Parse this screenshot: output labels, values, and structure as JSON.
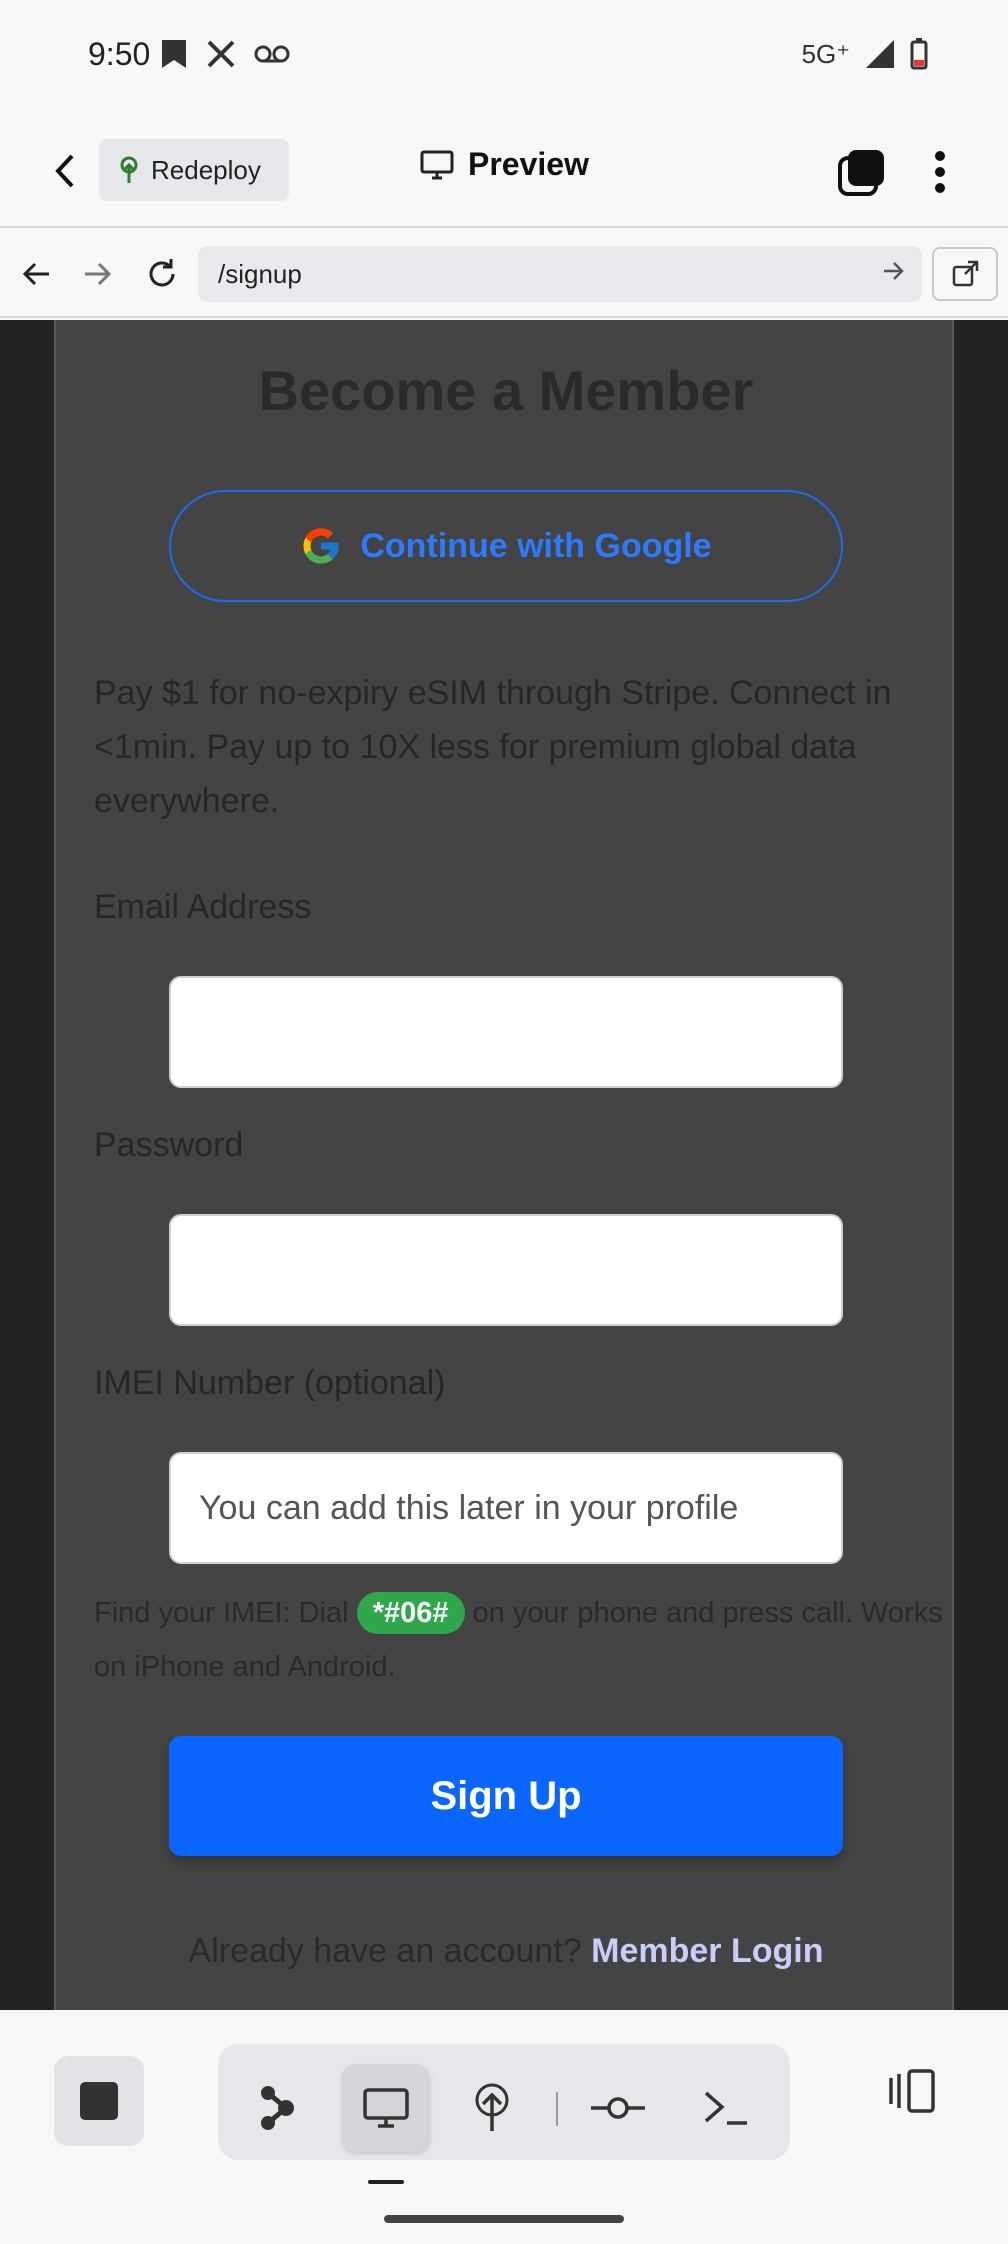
{
  "status_bar": {
    "time": "9:50",
    "network": "5G⁺",
    "left_icons": [
      "bookmark-icon",
      "x-icon",
      "voicemail-icon"
    ],
    "right_icons": [
      "signal-icon",
      "battery-low-icon"
    ]
  },
  "app_header": {
    "back_icon": "chevron-left-icon",
    "redeploy_label": "Redeploy",
    "title": "Preview",
    "title_icon": "monitor-icon",
    "tabs_icon": "tabs-icon",
    "more_icon": "more-vertical-icon"
  },
  "browser": {
    "url": "/signup"
  },
  "form": {
    "title": "Become a Member",
    "google_button": "Continue with Google",
    "description": "Pay $1 for no-expiry eSIM through Stripe. Connect in <1min. Pay up to 10X less for premium global data everywhere.",
    "email_label": "Email Address",
    "email_value": "",
    "password_label": "Password",
    "password_value": "",
    "imei_label": "IMEI Number (optional)",
    "imei_placeholder": "You can add this later in your profile",
    "hint_prefix": "Find your IMEI: Dial ",
    "hint_code": "*#06#",
    "hint_suffix": " on your phone and press call. Works on iPhone and Android.",
    "signup_button": "Sign Up",
    "login_prompt": "Already have an account? ",
    "login_link": "Member Login"
  },
  "bottom_bar": {
    "tools": [
      "agent-icon",
      "preview-icon",
      "deploy-icon",
      "git-icon",
      "terminal-icon"
    ],
    "active_tool": "preview-icon"
  },
  "colors": {
    "primary": "#0a66ff",
    "google_blue": "#2a7bff",
    "badge_green": "#2ea84a",
    "card_bg": "#444444",
    "page_bg": "#222222"
  }
}
